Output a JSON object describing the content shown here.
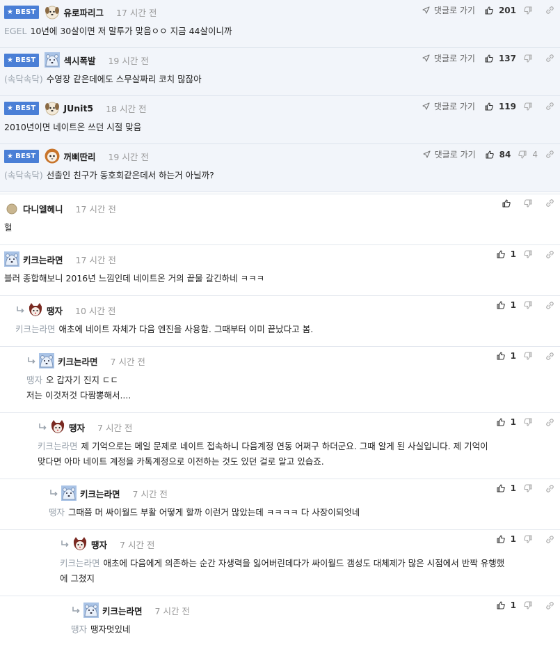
{
  "labels": {
    "best": "BEST",
    "reply_action": "댓글로 가기"
  },
  "colors": {
    "best_badge": "#4a7fd6",
    "best_background": "#f2f5fa",
    "mention": "#9aa3ad"
  },
  "best_comments": [
    {
      "nick": "유로파리그",
      "time": "17 시간 전",
      "mention": "EGEL",
      "text": "10년에 30살이면 저 말투가 맞음ㅇㅇ 지금 44살이니까",
      "up": "201",
      "down": "",
      "avatar_icon": "dog-avatar-icon"
    },
    {
      "nick": "섹시폭발",
      "time": "19 시간 전",
      "mention": "(속닥속닥)",
      "text": "수영장 같은데에도 스무살짜리 코치 많잖아",
      "up": "137",
      "down": "",
      "avatar_icon": "polar-bear-avatar-icon"
    },
    {
      "nick": "JUnit5",
      "time": "18 시간 전",
      "mention": "",
      "text": "2010년이면 네이트온 쓰던 시절 맞음",
      "up": "119",
      "down": "",
      "avatar_icon": "dog-avatar-icon"
    },
    {
      "nick": "꺼삐딴리",
      "time": "19 시간 전",
      "mention": "(속닥속닥)",
      "text": "선출인 친구가 동호회같은데서 하는거 아닐까?",
      "up": "84",
      "down": "4",
      "avatar_icon": "lion-avatar-icon"
    }
  ],
  "comments": [
    {
      "nick": "다니엘헤니",
      "time": "17 시간 전",
      "mention": "",
      "lines": [
        "헐"
      ],
      "up": "",
      "depth": 0,
      "avatar_icon": "circle-avatar-icon"
    },
    {
      "nick": "키크는라면",
      "time": "17 시간 전",
      "mention": "",
      "lines": [
        "블러 종합해보니 2016년 느낌인데 네이트온 거의 끝물 갈긴하네 ㅋㅋㅋ"
      ],
      "up": "1",
      "depth": 0,
      "avatar_icon": "polar-bear-avatar-icon"
    },
    {
      "nick": "땡자",
      "time": "10 시간 전",
      "mention": "키크는라면",
      "lines": [
        "애초에 네이트 자체가 다음 엔진을 사용함. 그때부터 이미 끝났다고 봄."
      ],
      "up": "1",
      "depth": 1,
      "avatar_icon": "cat-avatar-icon"
    },
    {
      "nick": "키크는라면",
      "time": "7 시간 전",
      "mention": "땡자",
      "lines": [
        "오 갑자기 진지 ㄷㄷ",
        "저는 이것저것 다짬뽕해서...."
      ],
      "up": "1",
      "depth": 2,
      "avatar_icon": "polar-bear-avatar-icon"
    },
    {
      "nick": "땡자",
      "time": "7 시간 전",
      "mention": "키크는라면",
      "lines": [
        "제 기억으로는 메일 문제로 네이트 접속하니 다음계정 연동 어쩌구 하더군요. 그때 알게 된 사실입니다. 제 기억이",
        "맞다면 아마 네이트 계정을 카톡계정으로 이전하는 것도 있던 걸로 알고 있습죠."
      ],
      "up": "1",
      "depth": 3,
      "avatar_icon": "cat-avatar-icon"
    },
    {
      "nick": "키크는라면",
      "time": "7 시간 전",
      "mention": "땡자",
      "lines": [
        "그때쯤 머 싸이월드 부활 어떻게 할까 이런거 많았는데 ㅋㅋㅋㅋ 다 사장이되엇네"
      ],
      "up": "1",
      "depth": 4,
      "avatar_icon": "polar-bear-avatar-icon"
    },
    {
      "nick": "땡자",
      "time": "7 시간 전",
      "mention": "키크는라면",
      "lines": [
        "애초에 다음에게 의존하는 순간 자생력을 잃어버린데다가 싸이월드 갬성도 대체제가 많은 시점에서 반짝 유행했",
        "에 그쳤지"
      ],
      "up": "1",
      "depth": 5,
      "avatar_icon": "cat-avatar-icon"
    },
    {
      "nick": "키크는라면",
      "time": "7 시간 전",
      "mention": "땡자",
      "lines": [
        "땡자멋있네"
      ],
      "up": "1",
      "depth": 6,
      "avatar_icon": "polar-bear-avatar-icon"
    }
  ]
}
